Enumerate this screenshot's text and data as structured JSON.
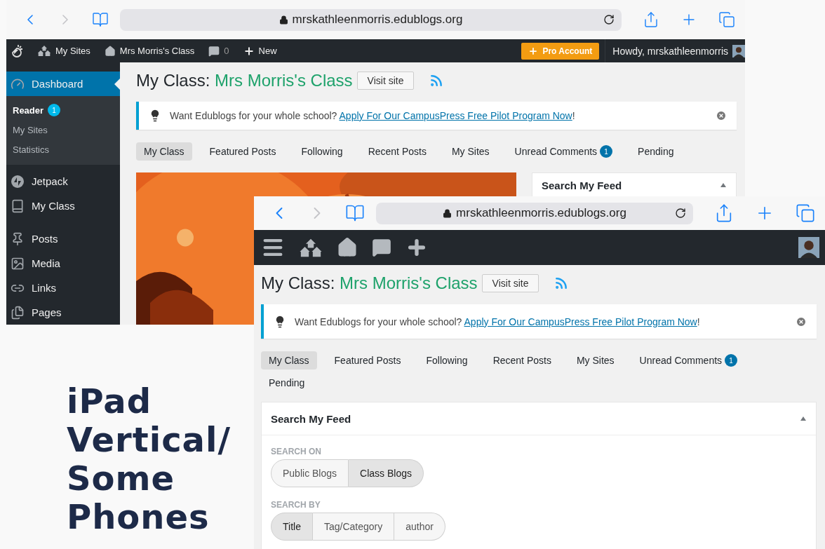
{
  "back_window": {
    "url": "mrskathleenmorris.edublogs.org",
    "admin_bar": {
      "sites": "My Sites",
      "site": "Mrs Morris's Class",
      "comments": "0",
      "new": "New",
      "pro": "Pro Account",
      "greeting": "Howdy, mrskathleenmorris"
    },
    "sidebar": [
      {
        "label": "Dashboard",
        "selected": true,
        "children": [
          {
            "label": "Reader",
            "selected": true,
            "badge": "1"
          },
          {
            "label": "My Sites",
            "selected": false
          },
          {
            "label": "Statistics",
            "selected": false
          }
        ]
      },
      {
        "label": "Jetpack",
        "selected": false
      },
      {
        "label": "My Class",
        "selected": false
      },
      {
        "label": "Posts",
        "selected": false
      },
      {
        "label": "Media",
        "selected": false
      },
      {
        "label": "Links",
        "selected": false
      },
      {
        "label": "Pages",
        "selected": false
      }
    ],
    "title": {
      "prefix": "My Class:",
      "site": "Mrs Morris's Class",
      "button": "Visit site"
    },
    "notice": {
      "text": "Want Edublogs for your whole school?",
      "link": "Apply For Our CampusPress Free Pilot Program Now",
      "suffix": "!"
    },
    "tabs": [
      {
        "label": "My Class",
        "selected": true
      },
      {
        "label": "Featured Posts",
        "selected": false
      },
      {
        "label": "Following",
        "selected": false
      },
      {
        "label": "Recent Posts",
        "selected": false
      },
      {
        "label": "My Sites",
        "selected": false
      },
      {
        "label": "Unread Comments",
        "selected": false,
        "badge": "1"
      },
      {
        "label": "Pending",
        "selected": false
      }
    ],
    "widget": {
      "title": "Search My Feed",
      "expanded": true
    }
  },
  "front_window": {
    "url": "mrskathleenmorris.edublogs.org",
    "title": {
      "prefix": "My Class:",
      "site": "Mrs Morris's Class",
      "button": "Visit site"
    },
    "notice": {
      "text": "Want Edublogs for your whole school?",
      "link": "Apply For Our CampusPress Free Pilot Program Now",
      "suffix": "!"
    },
    "tabs": [
      {
        "label": "My Class",
        "selected": true
      },
      {
        "label": "Featured Posts",
        "selected": false
      },
      {
        "label": "Following",
        "selected": false
      },
      {
        "label": "Recent Posts",
        "selected": false
      },
      {
        "label": "My Sites",
        "selected": false
      },
      {
        "label": "Unread Comments",
        "selected": false,
        "badge": "1"
      },
      {
        "label": "Pending",
        "selected": false
      }
    ],
    "widget": {
      "title": "Search My Feed",
      "expanded": true,
      "groups": [
        {
          "label": "SEARCH ON",
          "options": [
            {
              "label": "Public Blogs",
              "selected": false
            },
            {
              "label": "Class Blogs",
              "selected": true
            }
          ]
        },
        {
          "label": "SEARCH BY",
          "options": [
            {
              "label": "Title",
              "selected": true
            },
            {
              "label": "Tag/Category",
              "selected": false
            },
            {
              "label": "author",
              "selected": false
            }
          ]
        }
      ]
    }
  },
  "caption": [
    "iPad",
    "Vertical/",
    "Some",
    "Phones"
  ]
}
